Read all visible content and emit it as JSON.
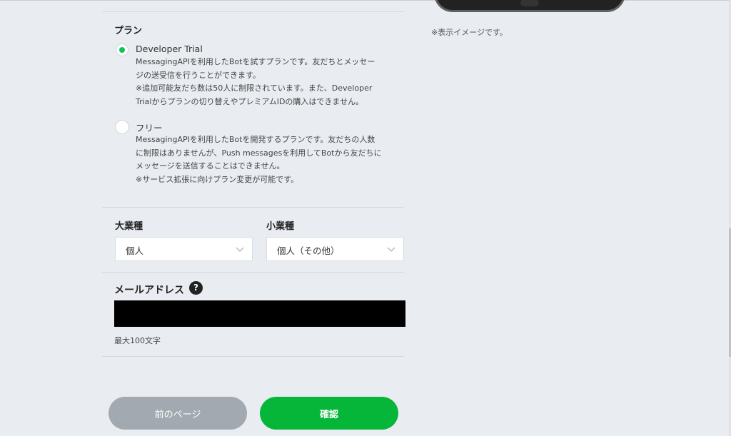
{
  "preview": {
    "note": "※表示イメージです。"
  },
  "plan": {
    "title": "プラン",
    "options": [
      {
        "label": "Developer Trial",
        "selected": true,
        "desc": [
          "MessagingAPIを利用したBotを試すプランです。友だちとメッセー",
          "ジの送受信を行うことができます。",
          "※追加可能友だち数は50人に制限されています。また、Developer",
          "Trialからプランの切り替えやプレミアムIDの購入はできません。"
        ]
      },
      {
        "label": "フリー",
        "selected": false,
        "desc": [
          "MessagingAPIを利用したBotを開発するプランです。友だちの人数",
          "に制限はありませんが、Push messagesを利用してBotから友だちに",
          "メッセージを送信することはできません。",
          "※サービス拡張に向けプラン変更が可能です。"
        ]
      }
    ]
  },
  "industry": {
    "major_label": "大業種",
    "major_value": "個人",
    "minor_label": "小業種",
    "minor_value": "個人（その他）"
  },
  "email": {
    "label": "メールアドレス",
    "help": "?",
    "value": "",
    "hint": "最大100文字"
  },
  "buttons": {
    "prev": "前のページ",
    "confirm": "確認"
  },
  "colors": {
    "accent": "#06c755",
    "button_confirm": "#06b639",
    "button_prev": "#a2a9b0"
  }
}
